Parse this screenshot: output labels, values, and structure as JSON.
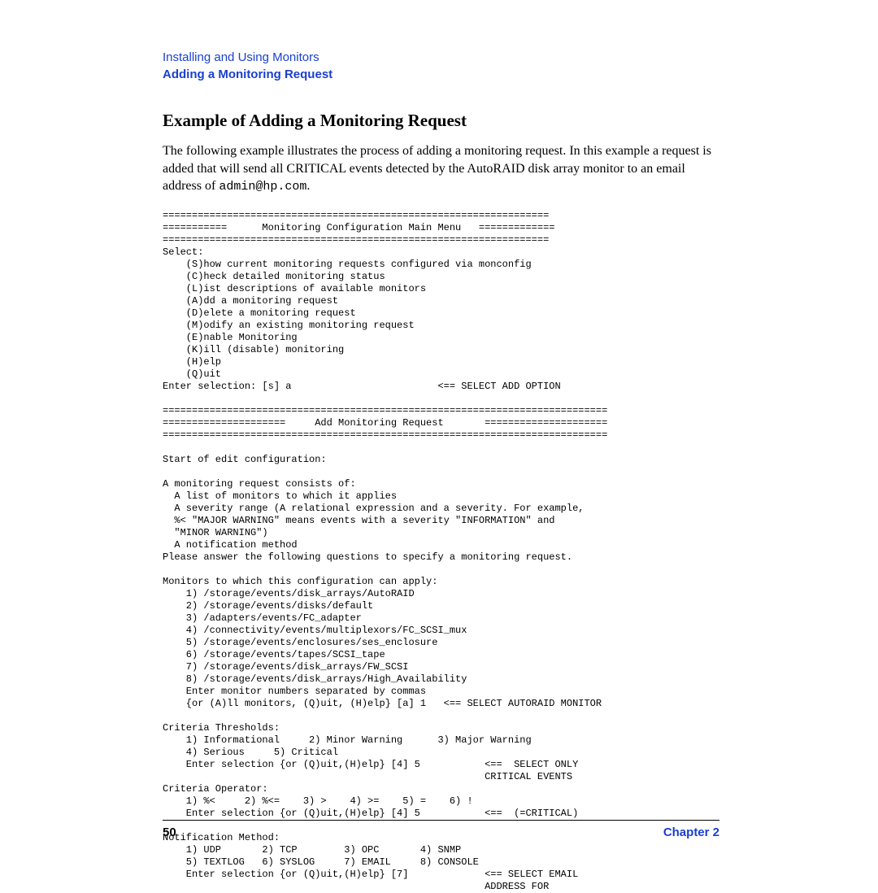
{
  "header": {
    "chapter_title": "Installing and Using Monitors",
    "section_title": "Adding a Monitoring Request"
  },
  "heading": "Example of Adding a Monitoring Request",
  "intro_parts": {
    "before_code": "The following example illustrates the process of adding a monitoring request. In this example a request is added that will send all CRITICAL events detected by the AutoRAID disk array monitor to an email address of ",
    "code": "admin@hp.com",
    "after_code": "."
  },
  "console": "==================================================================\n===========      Monitoring Configuration Main Menu   =============\n==================================================================\nSelect:\n    (S)how current monitoring requests configured via monconfig\n    (C)heck detailed monitoring status\n    (L)ist descriptions of available monitors\n    (A)dd a monitoring request\n    (D)elete a monitoring request\n    (M)odify an existing monitoring request\n    (E)nable Monitoring\n    (K)ill (disable) monitoring\n    (H)elp\n    (Q)uit\nEnter selection: [s] a                         <== SELECT ADD OPTION\n\n============================================================================\n=====================     Add Monitoring Request       =====================\n============================================================================\n\nStart of edit configuration:\n\nA monitoring request consists of:\n  A list of monitors to which it applies\n  A severity range (A relational expression and a severity. For example,\n  %< \"MAJOR WARNING\" means events with a severity \"INFORMATION\" and\n  \"MINOR WARNING\")\n  A notification method\nPlease answer the following questions to specify a monitoring request.\n\nMonitors to which this configuration can apply:\n    1) /storage/events/disk_arrays/AutoRAID\n    2) /storage/events/disks/default\n    3) /adapters/events/FC_adapter\n    4) /connectivity/events/multiplexors/FC_SCSI_mux\n    5) /storage/events/enclosures/ses_enclosure\n    6) /storage/events/tapes/SCSI_tape\n    7) /storage/events/disk_arrays/FW_SCSI\n    8) /storage/events/disk_arrays/High_Availability\n    Enter monitor numbers separated by commas\n    {or (A)ll monitors, (Q)uit, (H)elp} [a] 1   <== SELECT AUTORAID MONITOR\n\nCriteria Thresholds:\n    1) Informational     2) Minor Warning      3) Major Warning\n    4) Serious     5) Critical\n    Enter selection {or (Q)uit,(H)elp} [4] 5           <==  SELECT ONLY\n                                                       CRITICAL EVENTS\nCriteria Operator:\n    1) %<     2) %<=    3) >    4) >=    5) =    6) !\n    Enter selection {or (Q)uit,(H)elp} [4] 5           <==  (=CRITICAL)\n\nNotification Method:\n    1) UDP       2) TCP        3) OPC       4) SNMP\n    5) TEXTLOG   6) SYSLOG     7) EMAIL     8) CONSOLE\n    Enter selection {or (Q)uit,(H)elp} [7]             <== SELECT EMAIL\n                                                       ADDRESS FOR",
  "footer": {
    "page_number": "50",
    "chapter_label": "Chapter 2"
  }
}
